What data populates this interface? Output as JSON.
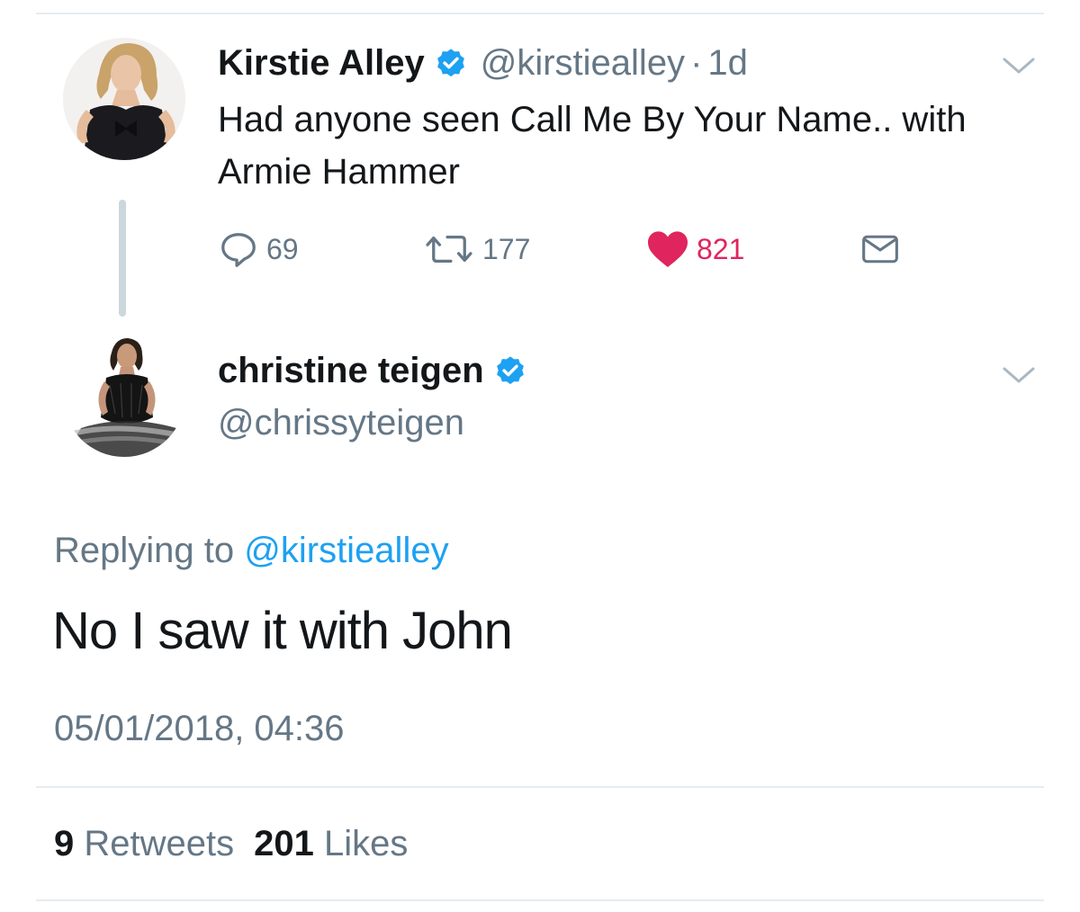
{
  "parent_tweet": {
    "author_name": "Kirstie Alley",
    "handle": "@kirstiealley",
    "separator": "·",
    "time": "1d",
    "text": "Had anyone seen Call Me By Your Name.. with Armie Hammer",
    "reply_count": "69",
    "retweet_count": "177",
    "like_count": "821",
    "liked": true
  },
  "reply_tweet": {
    "author_name": "christine teigen",
    "handle": "@chrissyteigen",
    "replying_prefix": "Replying to",
    "replying_mention": "@kirstiealley",
    "text": "No I saw it with John",
    "timestamp": "05/01/2018, 04:36",
    "retweets_count": "9",
    "retweets_label": "Retweets",
    "likes_count": "201",
    "likes_label": "Likes"
  },
  "colors": {
    "verified_badge": "#1da1f2",
    "like_active": "#e0245e",
    "secondary_text": "#657786",
    "mention": "#1da1f2"
  }
}
